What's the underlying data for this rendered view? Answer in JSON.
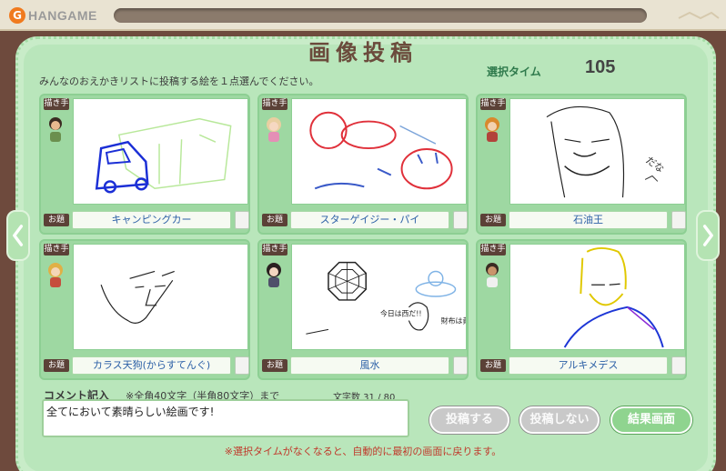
{
  "header": {
    "logo_text": "HANGAME",
    "logo_glyph": "G"
  },
  "dialog": {
    "title": "画像投稿",
    "instruction": "みんなのおえかきリストに投稿する絵を１点選んでください。",
    "timer_label": "選択タイム",
    "timer_value": "105"
  },
  "labels": {
    "artist": "描き手",
    "theme": "お題"
  },
  "cards": [
    {
      "theme": "キャンピングカー"
    },
    {
      "theme": "スターゲイジー・パイ"
    },
    {
      "theme": "石油王",
      "doodle_text": "だな"
    },
    {
      "theme": "カラス天狗(からすてんぐ)"
    },
    {
      "theme": "風水",
      "doodle_text_1": "今日は西だ!!",
      "doodle_text_2": "財布は黄"
    },
    {
      "theme": "アルキメデス"
    }
  ],
  "comment": {
    "title": "コメント記入",
    "hint": "※全角40文字（半角80文字）まで",
    "count": "文字数 31 / 80",
    "value": "全てにおいて素晴らしい絵画です!"
  },
  "buttons": {
    "post": "投稿する",
    "no_post": "投稿しない",
    "results": "結果画面"
  },
  "notice": "※選択タイムがなくなると、自動的に最初の画面に戻ります。",
  "colors": {
    "accent_green": "#8fd48f",
    "frame_brown": "#6e4a3d",
    "panel_green": "#b9e6bb",
    "notice_red": "#c0392b"
  },
  "icons": [
    "arrow-left-icon",
    "arrow-right-icon",
    "avatar-icon"
  ]
}
